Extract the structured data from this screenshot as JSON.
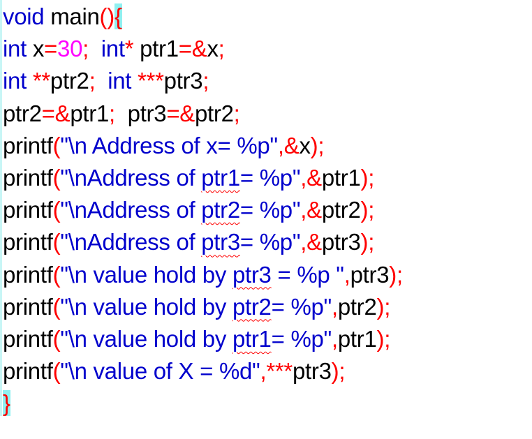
{
  "editor": {
    "colors": {
      "keyword": "#0000cc",
      "identifier": "#000000",
      "operator": "#ff0000",
      "number": "#ff00ff",
      "string": "#0000cc",
      "brace_highlight": "#8ff0f0",
      "spell_squiggle": "#ff0000"
    },
    "lines": [
      {
        "tokens": [
          {
            "t": "void",
            "k": "kw"
          },
          {
            "t": " main",
            "k": "id"
          },
          {
            "t": "()",
            "k": "op"
          },
          {
            "t": "{",
            "k": "brace-hl"
          }
        ]
      },
      {
        "tokens": [
          {
            "t": "int",
            "k": "kw"
          },
          {
            "t": " x",
            "k": "id"
          },
          {
            "t": "=",
            "k": "op"
          },
          {
            "t": "30",
            "k": "num"
          },
          {
            "t": ";  ",
            "k": "op"
          },
          {
            "t": "int",
            "k": "kw"
          },
          {
            "t": "* ",
            "k": "op"
          },
          {
            "t": "ptr1",
            "k": "id"
          },
          {
            "t": "=&",
            "k": "op"
          },
          {
            "t": "x",
            "k": "id"
          },
          {
            "t": ";",
            "k": "op"
          }
        ]
      },
      {
        "tokens": [
          {
            "t": "int",
            "k": "kw"
          },
          {
            "t": " **",
            "k": "op"
          },
          {
            "t": "ptr2",
            "k": "id"
          },
          {
            "t": ";  ",
            "k": "op"
          },
          {
            "t": "int",
            "k": "kw"
          },
          {
            "t": " ***",
            "k": "op"
          },
          {
            "t": "ptr3",
            "k": "id"
          },
          {
            "t": ";",
            "k": "op"
          }
        ]
      },
      {
        "tokens": [
          {
            "t": "ptr2",
            "k": "id"
          },
          {
            "t": "=&",
            "k": "op"
          },
          {
            "t": "ptr1",
            "k": "id"
          },
          {
            "t": ";  ",
            "k": "op"
          },
          {
            "t": "ptr3",
            "k": "id"
          },
          {
            "t": "=&",
            "k": "op"
          },
          {
            "t": "ptr2",
            "k": "id"
          },
          {
            "t": ";",
            "k": "op"
          }
        ]
      },
      {
        "tokens": [
          {
            "t": "printf",
            "k": "id"
          },
          {
            "t": "(",
            "k": "op"
          },
          {
            "t": "\"\\n Address of x= %p\"",
            "k": "str"
          },
          {
            "t": ",&",
            "k": "op"
          },
          {
            "t": "x",
            "k": "id"
          },
          {
            "t": ");",
            "k": "op"
          }
        ]
      },
      {
        "tokens": [
          {
            "t": "printf",
            "k": "id"
          },
          {
            "t": "(",
            "k": "op"
          },
          {
            "t": "\"\\nAddress of ",
            "k": "str"
          },
          {
            "t": "ptr1",
            "k": "str-sq"
          },
          {
            "t": "= %p\"",
            "k": "str"
          },
          {
            "t": ",&",
            "k": "op"
          },
          {
            "t": "ptr1",
            "k": "id"
          },
          {
            "t": ");",
            "k": "op"
          }
        ]
      },
      {
        "tokens": [
          {
            "t": "printf",
            "k": "id"
          },
          {
            "t": "(",
            "k": "op"
          },
          {
            "t": "\"\\nAddress of ",
            "k": "str"
          },
          {
            "t": "ptr2",
            "k": "str-sq"
          },
          {
            "t": "= %p\"",
            "k": "str"
          },
          {
            "t": ",&",
            "k": "op"
          },
          {
            "t": "ptr2",
            "k": "id"
          },
          {
            "t": ");",
            "k": "op"
          }
        ]
      },
      {
        "tokens": [
          {
            "t": "printf",
            "k": "id"
          },
          {
            "t": "(",
            "k": "op"
          },
          {
            "t": "\"\\nAddress of ",
            "k": "str"
          },
          {
            "t": "ptr3",
            "k": "str-sq"
          },
          {
            "t": "= %p\"",
            "k": "str"
          },
          {
            "t": ",&",
            "k": "op"
          },
          {
            "t": "ptr3",
            "k": "id"
          },
          {
            "t": ");",
            "k": "op"
          }
        ]
      },
      {
        "tokens": [
          {
            "t": "printf",
            "k": "id"
          },
          {
            "t": "(",
            "k": "op"
          },
          {
            "t": "\"\\n value hold by ",
            "k": "str"
          },
          {
            "t": "ptr3",
            "k": "str-sq"
          },
          {
            "t": " = %p \"",
            "k": "str"
          },
          {
            "t": ",",
            "k": "op"
          },
          {
            "t": "ptr3",
            "k": "id"
          },
          {
            "t": ");",
            "k": "op"
          }
        ]
      },
      {
        "tokens": [
          {
            "t": "printf",
            "k": "id"
          },
          {
            "t": "(",
            "k": "op"
          },
          {
            "t": "\"\\n value hold by ",
            "k": "str"
          },
          {
            "t": "ptr2",
            "k": "str-sq"
          },
          {
            "t": "= %p\"",
            "k": "str"
          },
          {
            "t": ",",
            "k": "op"
          },
          {
            "t": "ptr2",
            "k": "id"
          },
          {
            "t": ");",
            "k": "op"
          }
        ]
      },
      {
        "tokens": [
          {
            "t": "printf",
            "k": "id"
          },
          {
            "t": "(",
            "k": "op"
          },
          {
            "t": "\"\\n value hold by ",
            "k": "str"
          },
          {
            "t": "ptr1",
            "k": "str-sq"
          },
          {
            "t": "= %p\"",
            "k": "str"
          },
          {
            "t": ",",
            "k": "op"
          },
          {
            "t": "ptr1",
            "k": "id"
          },
          {
            "t": ");",
            "k": "op"
          }
        ]
      },
      {
        "tokens": [
          {
            "t": "printf",
            "k": "id"
          },
          {
            "t": "(",
            "k": "op"
          },
          {
            "t": "\"\\n value of X = %d\"",
            "k": "str"
          },
          {
            "t": ",***",
            "k": "op"
          },
          {
            "t": "ptr3",
            "k": "id"
          },
          {
            "t": ");",
            "k": "op"
          }
        ]
      },
      {
        "tokens": [
          {
            "t": "}",
            "k": "brace-hl"
          }
        ]
      }
    ]
  }
}
